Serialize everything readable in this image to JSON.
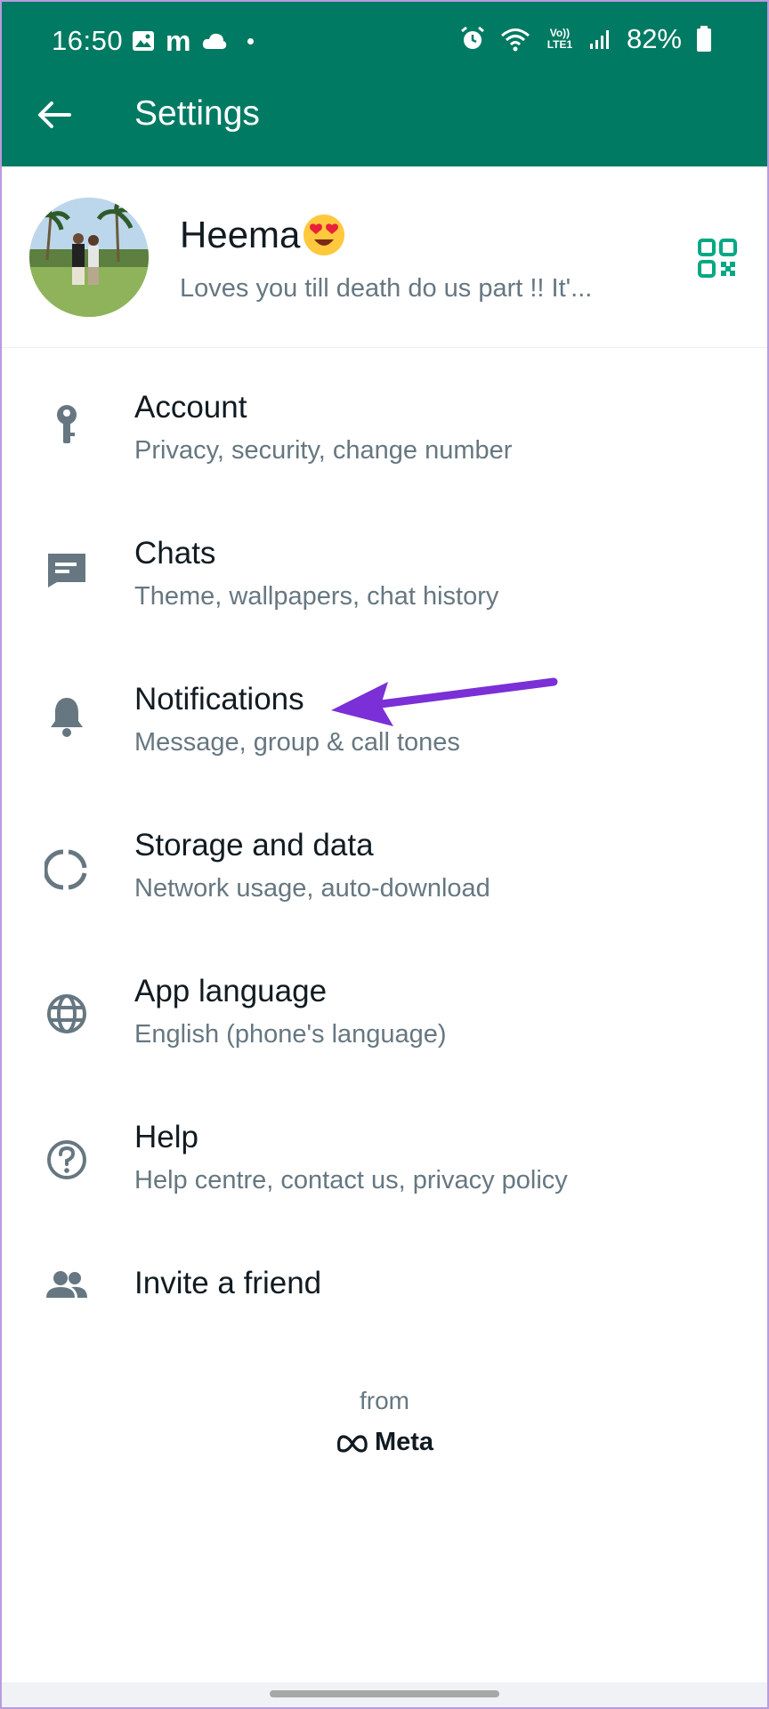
{
  "status_bar": {
    "time": "16:50",
    "network": "Vo)) LTE1",
    "battery": "82%"
  },
  "app_bar": {
    "title": "Settings",
    "back_icon": "arrow-left-icon"
  },
  "profile": {
    "name": "Heema",
    "emoji": "heart-eyes-emoji",
    "about": "Loves you till death do us part !! It'...",
    "qr_icon": "qr-code-icon"
  },
  "settings": [
    {
      "key": "account",
      "icon": "key-icon",
      "title": "Account",
      "subtitle": "Privacy, security, change number"
    },
    {
      "key": "chats",
      "icon": "chat-icon",
      "title": "Chats",
      "subtitle": "Theme, wallpapers, chat history"
    },
    {
      "key": "notifications",
      "icon": "bell-icon",
      "title": "Notifications",
      "subtitle": "Message, group & call tones"
    },
    {
      "key": "storage",
      "icon": "storage-circle-icon",
      "title": "Storage and data",
      "subtitle": "Network usage, auto-download"
    },
    {
      "key": "language",
      "icon": "globe-icon",
      "title": "App language",
      "subtitle": "English (phone's language)"
    },
    {
      "key": "help",
      "icon": "help-circle-icon",
      "title": "Help",
      "subtitle": "Help centre, contact us, privacy policy"
    },
    {
      "key": "invite",
      "icon": "people-icon",
      "title": "Invite a friend",
      "subtitle": ""
    }
  ],
  "footer": {
    "from": "from",
    "brand": "Meta"
  },
  "colors": {
    "header": "#007a62",
    "accent": "#00a884",
    "icon_grey": "#667781",
    "annotation": "#7b2fd6"
  }
}
